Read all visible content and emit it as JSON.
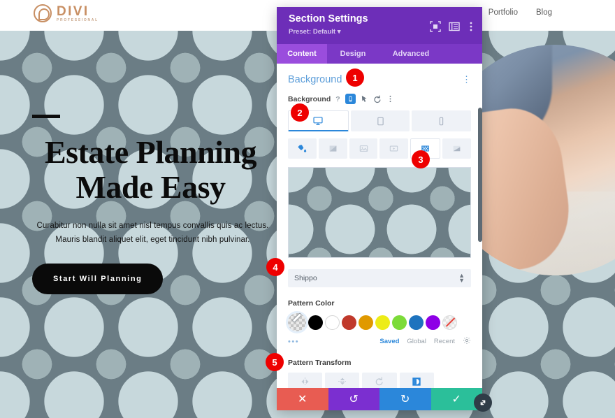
{
  "site": {
    "logo": {
      "name": "DIVI",
      "tagline": "PROFESSIONAL"
    },
    "nav": [
      {
        "label": "Portfolio"
      },
      {
        "label": "Blog"
      }
    ]
  },
  "hero": {
    "title": "Estate Planning Made Easy",
    "subtitle": "Curabitur non nulla sit amet nisl tempus convallis quis ac lectus. Mauris blandit aliquet elit, eget tincidunt nibh pulvinar.",
    "cta_label": "Start Will Planning"
  },
  "modal": {
    "title": "Section Settings",
    "preset": "Preset: Default",
    "header_icons": [
      {
        "name": "expand-icon"
      },
      {
        "name": "layout-icon"
      },
      {
        "name": "kebab-menu-icon"
      }
    ],
    "tabs": [
      {
        "label": "Content",
        "active": true
      },
      {
        "label": "Design",
        "active": false
      },
      {
        "label": "Advanced",
        "active": false
      }
    ],
    "section": {
      "title": "Background",
      "field_label": "Background",
      "field_icons": [
        {
          "name": "help-icon",
          "glyph": "?"
        },
        {
          "name": "responsive-icon"
        },
        {
          "name": "hover-icon"
        },
        {
          "name": "reset-icon"
        },
        {
          "name": "options-kebab-icon"
        }
      ]
    },
    "device_tabs": [
      {
        "name": "desktop",
        "active": true
      },
      {
        "name": "tablet",
        "active": false
      },
      {
        "name": "phone",
        "active": false
      }
    ],
    "background_types": [
      {
        "name": "color-fill",
        "active": false
      },
      {
        "name": "gradient",
        "active": false
      },
      {
        "name": "image",
        "active": false
      },
      {
        "name": "video",
        "active": false
      },
      {
        "name": "pattern",
        "active": true
      },
      {
        "name": "mask",
        "active": false
      }
    ],
    "pattern": {
      "selected": "Shippo",
      "base_color": "#6b7d85",
      "shape_color": "#9fb2b6"
    },
    "pattern_color": {
      "label": "Pattern Color",
      "swatches": [
        {
          "name": "eyedropper-transparent",
          "color": "transparent",
          "selected": true
        },
        {
          "name": "black",
          "color": "#000000"
        },
        {
          "name": "white",
          "color": "#ffffff"
        },
        {
          "name": "dark-red",
          "color": "#c0392b"
        },
        {
          "name": "orange",
          "color": "#e09900"
        },
        {
          "name": "yellow",
          "color": "#edec17"
        },
        {
          "name": "green",
          "color": "#7cdb39"
        },
        {
          "name": "blue",
          "color": "#1e73be"
        },
        {
          "name": "purple",
          "color": "#8e00e6"
        },
        {
          "name": "none",
          "color": "none"
        }
      ],
      "more_dots": "•••",
      "tabs": [
        {
          "label": "Saved",
          "active": true
        },
        {
          "label": "Global",
          "active": false
        },
        {
          "label": "Recent",
          "active": false
        }
      ]
    },
    "pattern_transform": {
      "label": "Pattern Transform",
      "buttons": [
        {
          "name": "flip-horizontal",
          "active": false
        },
        {
          "name": "flip-vertical",
          "active": false
        },
        {
          "name": "rotate",
          "active": false
        },
        {
          "name": "invert",
          "active": true
        }
      ]
    },
    "footer_buttons": [
      {
        "name": "cancel",
        "glyph": "✕",
        "color": "#e85c52"
      },
      {
        "name": "undo",
        "glyph": "↺",
        "color": "#7b2fd0"
      },
      {
        "name": "redo",
        "glyph": "↻",
        "color": "#2b87da"
      },
      {
        "name": "save",
        "glyph": "✓",
        "color": "#2bbf9a"
      }
    ]
  },
  "badges": [
    {
      "n": "1"
    },
    {
      "n": "2"
    },
    {
      "n": "3"
    },
    {
      "n": "4"
    },
    {
      "n": "5"
    }
  ]
}
